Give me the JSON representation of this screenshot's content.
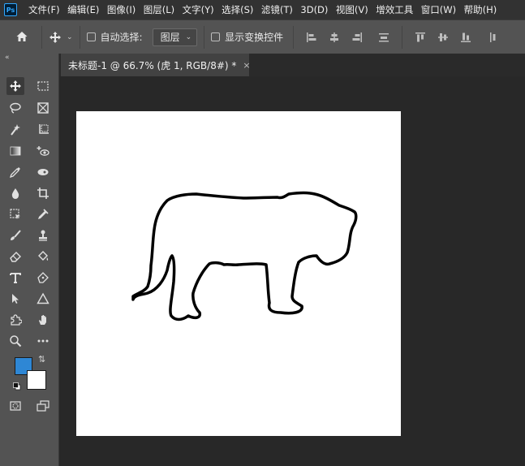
{
  "app": {
    "logo_text": "Ps"
  },
  "menu": {
    "items": [
      "文件(F)",
      "编辑(E)",
      "图像(I)",
      "图层(L)",
      "文字(Y)",
      "选择(S)",
      "滤镜(T)",
      "3D(D)",
      "视图(V)",
      "增效工具",
      "窗口(W)",
      "帮助(H)"
    ]
  },
  "options_bar": {
    "auto_select_label": "自动选择:",
    "auto_select_checked": false,
    "auto_select_target": "图层",
    "show_transform_label": "显示变换控件",
    "show_transform_checked": false
  },
  "document": {
    "tab_title": "未标题-1 @ 66.7% (虎 1, RGB/8#) *",
    "close_glyph": "×"
  },
  "toolbar": {
    "collapse_glyph": "«",
    "foreground_color": "#2e87d5",
    "background_color": "#ffffff"
  },
  "colors": {
    "app_bg": "#282828",
    "panel": "#535353",
    "menubar": "#323232",
    "accent": "#31a8ff"
  }
}
